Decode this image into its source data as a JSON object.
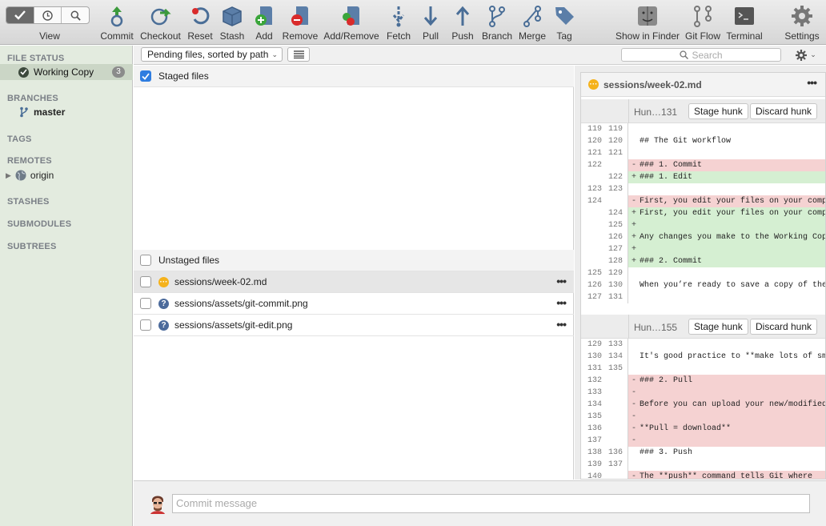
{
  "toolbar": {
    "view_label": "View",
    "buttons": [
      {
        "label": "Commit"
      },
      {
        "label": "Checkout"
      },
      {
        "label": "Reset"
      },
      {
        "label": "Stash"
      },
      {
        "label": "Add"
      },
      {
        "label": "Remove"
      },
      {
        "label": "Add/Remove"
      },
      {
        "label": "Fetch"
      },
      {
        "label": "Pull"
      },
      {
        "label": "Push"
      },
      {
        "label": "Branch"
      },
      {
        "label": "Merge"
      },
      {
        "label": "Tag"
      },
      {
        "label": "Show in Finder"
      },
      {
        "label": "Git Flow"
      },
      {
        "label": "Terminal"
      },
      {
        "label": "Settings"
      }
    ]
  },
  "sidebar": {
    "file_status": "FILE STATUS",
    "working_copy": "Working Copy",
    "working_copy_count": "3",
    "branches": "BRANCHES",
    "branch_master": "master",
    "tags": "TAGS",
    "remotes": "REMOTES",
    "remote_origin": "origin",
    "stashes": "STASHES",
    "submodules": "SUBMODULES",
    "subtrees": "SUBTREES"
  },
  "filter": {
    "sort_label": "Pending files, sorted by path",
    "search_placeholder": "Search"
  },
  "files": {
    "staged_header": "Staged files",
    "unstaged_header": "Unstaged files",
    "unstaged": [
      {
        "name": "sessions/week-02.md",
        "status": "modified"
      },
      {
        "name": "sessions/assets/git-commit.png",
        "status": "untracked"
      },
      {
        "name": "sessions/assets/git-edit.png",
        "status": "untracked"
      }
    ]
  },
  "diff": {
    "file": "sessions/week-02.md",
    "stage_hunk": "Stage hunk",
    "discard_hunk": "Discard hunk",
    "hunks": [
      {
        "name": "Hun…131",
        "lines": [
          {
            "o": "119",
            "n": "119",
            "t": " ",
            "text": ""
          },
          {
            "o": "120",
            "n": "120",
            "t": " ",
            "text": "## The Git workflow"
          },
          {
            "o": "121",
            "n": "121",
            "t": " ",
            "text": ""
          },
          {
            "o": "122",
            "n": "",
            "t": "-",
            "text": "### 1. Commit"
          },
          {
            "o": "",
            "n": "122",
            "t": "+",
            "text": "### 1. Edit"
          },
          {
            "o": "123",
            "n": "123",
            "t": " ",
            "text": ""
          },
          {
            "o": "124",
            "n": "",
            "t": "-",
            "text": "First, you edit your files on your computer"
          },
          {
            "o": "",
            "n": "124",
            "t": "+",
            "text": "First, you edit your files on your computer"
          },
          {
            "o": "",
            "n": "125",
            "t": "+",
            "text": ""
          },
          {
            "o": "",
            "n": "126",
            "t": "+",
            "text": "Any changes you make to the Working Copy"
          },
          {
            "o": "",
            "n": "127",
            "t": "+",
            "text": ""
          },
          {
            "o": "",
            "n": "128",
            "t": "+",
            "text": "### 2. Commit"
          },
          {
            "o": "125",
            "n": "129",
            "t": " ",
            "text": ""
          },
          {
            "o": "126",
            "n": "130",
            "t": " ",
            "text": "When you’re ready to save a copy of the"
          },
          {
            "o": "127",
            "n": "131",
            "t": " ",
            "text": ""
          }
        ]
      },
      {
        "name": "Hun…155",
        "lines": [
          {
            "o": "129",
            "n": "133",
            "t": " ",
            "text": ""
          },
          {
            "o": "130",
            "n": "134",
            "t": " ",
            "text": "It's good practice to **make lots of small"
          },
          {
            "o": "131",
            "n": "135",
            "t": " ",
            "text": ""
          },
          {
            "o": "132",
            "n": "",
            "t": "-",
            "text": "### 2. Pull"
          },
          {
            "o": "133",
            "n": "",
            "t": "-",
            "text": ""
          },
          {
            "o": "134",
            "n": "",
            "t": "-",
            "text": "Before you can upload your new/modified"
          },
          {
            "o": "135",
            "n": "",
            "t": "-",
            "text": ""
          },
          {
            "o": "136",
            "n": "",
            "t": "-",
            "text": "**Pull = download**"
          },
          {
            "o": "137",
            "n": "",
            "t": "-",
            "text": ""
          },
          {
            "o": "138",
            "n": "136",
            "t": " ",
            "text": "### 3. Push"
          },
          {
            "o": "139",
            "n": "137",
            "t": " ",
            "text": ""
          },
          {
            "o": "140",
            "n": "",
            "t": "-",
            "text": "The **push** command tells Git where"
          }
        ]
      }
    ]
  },
  "commit": {
    "placeholder": "Commit message"
  },
  "colors": {
    "sidebar_bg": "#e3ebdf",
    "selected_bg": "#cbd6c6",
    "accent": "#2f7de0",
    "deleted_bg": "#f5d2d2",
    "added_bg": "#d5efd2",
    "modified_icon": "#f5b21b",
    "untracked_icon": "#4b6a9b"
  }
}
